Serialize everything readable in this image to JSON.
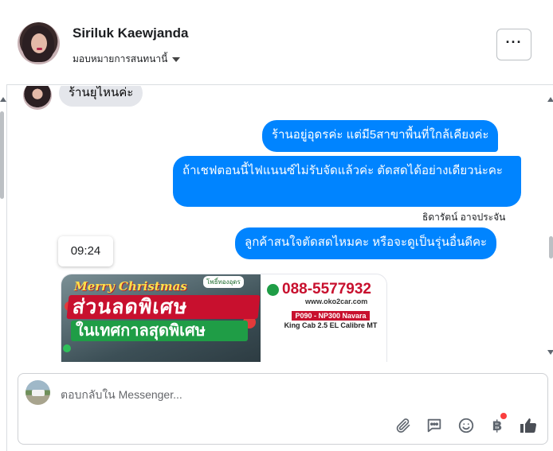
{
  "header": {
    "contact_name": "Siriluk Kaewjanda",
    "assign_label": "มอบหมายการสนทนานี้",
    "more_label": "···"
  },
  "thread": {
    "incoming_message": "ร้านยุไหนค่ะ",
    "outgoing_messages": [
      "ร้านอยู่อุดรค่ะ แต่มี5สาขาพื้นที่ใกล้เคียงค่ะ",
      "ถ้าเชฟตอนนี้ไฟแนนซ์ไม่รับจัดแล้วค่ะ ตัดสดได้อย่างเดียวน่ะคะ",
      "ลูกค้าสนใจตัดสดไหมคะ หรือจะดูเป็นรุ่นอื่นดีคะ"
    ],
    "sender_name": "ธิดารัตน์ อาจประจัน",
    "timestamp_tooltip": "09:24",
    "ad": {
      "headline_en": "Merry Christmas",
      "brand": "โพธิ์ทองอุดร",
      "discount": "ส่วนลดพิเศษ",
      "season": "ในเทศกาลสุดพิเศษ",
      "phone": "088-5577932",
      "website": "www.oko2car.com",
      "model_line1": "P090 - NP300 Navara",
      "model_line2": "King Cab 2.5 EL Calibre MT"
    }
  },
  "composer": {
    "placeholder": "ตอบกลับใน Messenger...",
    "tools": [
      "paperclip-icon",
      "quick-reply-icon",
      "emoji-icon",
      "baht-icon",
      "like-icon"
    ],
    "baht_symbol": "฿"
  },
  "colors": {
    "outgoing_bubble": "#0084ff",
    "incoming_bubble": "#e4e6eb",
    "notification": "#fa3e3e"
  }
}
